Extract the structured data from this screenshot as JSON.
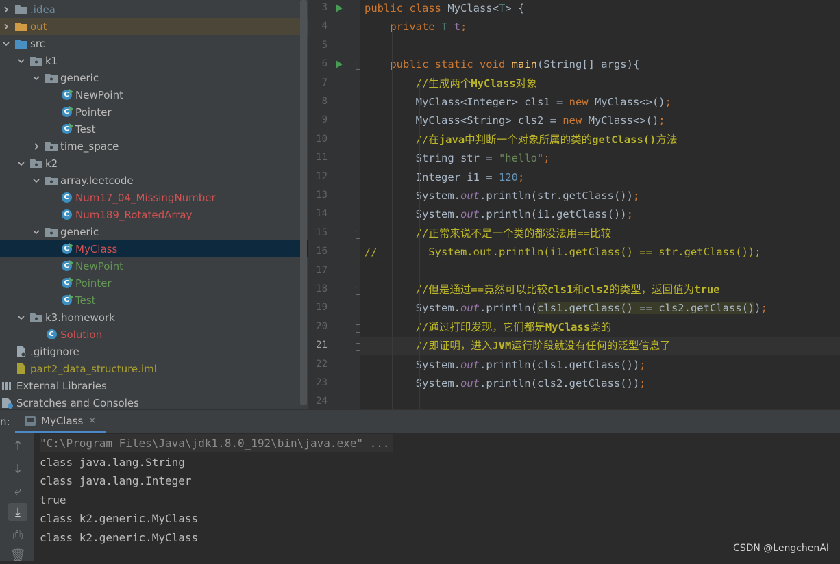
{
  "project_tree": {
    "items": [
      {
        "label": ".idea",
        "indent": 0,
        "chevron": "right",
        "icon": "folder",
        "color": "#6a8a9c"
      },
      {
        "label": "out",
        "indent": 0,
        "chevron": "right",
        "icon": "folder-orange",
        "color": "#c08a3e",
        "excluded": true
      },
      {
        "label": "src",
        "indent": 0,
        "chevron": "down",
        "icon": "folder-src",
        "color": "#bbbbbb"
      },
      {
        "label": "k1",
        "indent": 1,
        "chevron": "down",
        "icon": "package",
        "color": "#bbbbbb"
      },
      {
        "label": "generic",
        "indent": 2,
        "chevron": "down",
        "icon": "package",
        "color": "#bbbbbb"
      },
      {
        "label": "NewPoint",
        "indent": 3,
        "chevron": "none",
        "icon": "class-run",
        "color": "#bbbbbb"
      },
      {
        "label": "Pointer",
        "indent": 3,
        "chevron": "none",
        "icon": "class-run",
        "color": "#bbbbbb"
      },
      {
        "label": "Test",
        "indent": 3,
        "chevron": "none",
        "icon": "class-run",
        "color": "#bbbbbb"
      },
      {
        "label": "time_space",
        "indent": 2,
        "chevron": "right",
        "icon": "package",
        "color": "#bbbbbb"
      },
      {
        "label": "k2",
        "indent": 1,
        "chevron": "down",
        "icon": "package",
        "color": "#bbbbbb"
      },
      {
        "label": "array.leetcode",
        "indent": 2,
        "chevron": "down",
        "icon": "package",
        "color": "#bbbbbb"
      },
      {
        "label": "Num17_04_MissingNumber",
        "indent": 3,
        "chevron": "none",
        "icon": "class",
        "color": "#d25252"
      },
      {
        "label": "Num189_RotatedArray",
        "indent": 3,
        "chevron": "none",
        "icon": "class",
        "color": "#d25252"
      },
      {
        "label": "generic",
        "indent": 2,
        "chevron": "down",
        "icon": "package",
        "color": "#bbbbbb"
      },
      {
        "label": "MyClass",
        "indent": 3,
        "chevron": "none",
        "icon": "class-run",
        "color": "#d25252",
        "selected": true
      },
      {
        "label": "NewPoint",
        "indent": 3,
        "chevron": "none",
        "icon": "class-run",
        "color": "#629755"
      },
      {
        "label": "Pointer",
        "indent": 3,
        "chevron": "none",
        "icon": "class-run",
        "color": "#629755"
      },
      {
        "label": "Test",
        "indent": 3,
        "chevron": "none",
        "icon": "class-run",
        "color": "#629755"
      },
      {
        "label": "k3.homework",
        "indent": 1,
        "chevron": "down",
        "icon": "package",
        "color": "#bbbbbb"
      },
      {
        "label": "Solution",
        "indent": 2,
        "chevron": "none",
        "icon": "class",
        "color": "#d25252"
      },
      {
        "label": ".gitignore",
        "indent": 0,
        "chevron": "none",
        "icon": "file",
        "color": "#bbbbbb"
      },
      {
        "label": "part2_data_structure.iml",
        "indent": 0,
        "chevron": "none",
        "icon": "iml",
        "color": "#a8a032"
      },
      {
        "label": "External Libraries",
        "indent": -1,
        "chevron": "none",
        "icon": "libraries",
        "color": "#bbbbbb"
      },
      {
        "label": "Scratches and Consoles",
        "indent": -1,
        "chevron": "none",
        "icon": "scratches",
        "color": "#bbbbbb"
      }
    ]
  },
  "editor": {
    "current_line": 21,
    "run_lines": [
      3,
      6
    ],
    "fold_lines": [
      6,
      15,
      18,
      20,
      21
    ],
    "lines": [
      {
        "n": "3",
        "html": "<span class=\"kw\">public class </span>MyClass&lt;<span class=\"tp\">T</span>&gt; {"
      },
      {
        "n": "4",
        "html": "    <span class=\"kw\">private </span><span class=\"tp\">T </span><span class=\"fld\" style=\"font-style:normal;color:#9876aa\">t</span><span class=\"kw\">;</span>"
      },
      {
        "n": "5",
        "html": ""
      },
      {
        "n": "6",
        "html": "    <span class=\"kw\">public static void </span><span class=\"fn\">main</span>(String[] args){"
      },
      {
        "n": "7",
        "html": "        <span class=\"cm\">//生成两个<b>MyClass</b>对象</span>"
      },
      {
        "n": "8",
        "html": "        MyClass&lt;Integer&gt; cls1 = <span class=\"kw\">new </span>MyClass&lt;&gt;()<span class=\"kw\">;</span>"
      },
      {
        "n": "9",
        "html": "        MyClass&lt;String&gt; cls2 = <span class=\"kw\">new </span>MyClass&lt;&gt;()<span class=\"kw\">;</span>"
      },
      {
        "n": "10",
        "html": "        <span class=\"cm\">//在<b>java</b>中判断一个对象所属的类的<b>getClass()</b>方法</span>"
      },
      {
        "n": "11",
        "html": "        String str = <span class=\"st\">\"hello\"</span><span class=\"kw\">;</span>"
      },
      {
        "n": "12",
        "html": "        Integer i1 = <span class=\"num\">120</span><span class=\"kw\">;</span>"
      },
      {
        "n": "13",
        "html": "        System.<span class=\"fld\">out</span>.println(str.getClass())<span class=\"kw\">;</span>"
      },
      {
        "n": "14",
        "html": "        System.<span class=\"fld\">out</span>.println(i1.getClass())<span class=\"kw\">;</span>"
      },
      {
        "n": "15",
        "html": "        <span class=\"cm\">//正常来说不是一个类的都没法用==比较</span>"
      },
      {
        "n": "16",
        "html": "<span class=\"cm\">//        System.out.println(i1.getClass() == str.getClass());</span>"
      },
      {
        "n": "17",
        "html": ""
      },
      {
        "n": "18",
        "html": "        <span class=\"cm\">//但是通过==竟然可以比较<b>cls1</b>和<b>cls2</b>的类型，返回值为<b>true</b></span>"
      },
      {
        "n": "19",
        "html": "        System.<span class=\"fld\">out</span>.println(<span class=\"hl\">cls1.getClass() == cls2.getClass()</span>)<span class=\"kw\">;</span>"
      },
      {
        "n": "20",
        "html": "        <span class=\"cm\">//通过打印发现，它们都是<b>MyClass</b>类的</span>"
      },
      {
        "n": "21",
        "html": "        <span class=\"cm\">//即证明，进入<b>JVM</b>运行阶段就没有任何的泛型信息了</span>"
      },
      {
        "n": "22",
        "html": "        System.<span class=\"fld\">out</span>.println(cls1.getClass())<span class=\"kw\">;</span>"
      },
      {
        "n": "23",
        "html": "        System.<span class=\"fld\">out</span>.println(cls2.getClass())<span class=\"kw\">;</span>"
      },
      {
        "n": "24",
        "html": ""
      }
    ]
  },
  "run_panel": {
    "prefix": "n:",
    "tab_label": "MyClass",
    "close_glyph": "×",
    "tools": [
      "↑",
      "↓",
      "⤶",
      "⤓",
      "⎙",
      "🗑"
    ],
    "output": [
      "\"C:\\Program Files\\Java\\jdk1.8.0_192\\bin\\java.exe\" ...",
      "class java.lang.String",
      "class java.lang.Integer",
      "true",
      "class k2.generic.MyClass",
      "class k2.generic.MyClass"
    ]
  },
  "watermark": "CSDN @LengchenAI"
}
